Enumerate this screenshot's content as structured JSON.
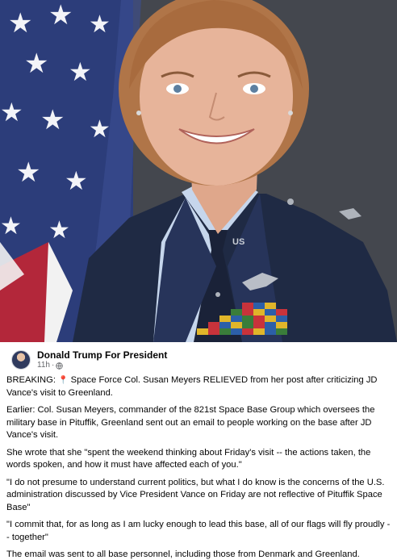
{
  "post": {
    "author": "Donald Trump For President",
    "time": "11h",
    "dot": "·",
    "paragraphs": {
      "p1_before": "BREAKING: ",
      "p1_emoji": "📍",
      "p1_after": " Space Force Col. Susan Meyers RELIEVED from her post after criticizing JD Vance's visit to Greenland.",
      "p2": "Earlier: Col. Susan Meyers, commander of the 821st Space Base Group which oversees the military base in Pituffik, Greenland sent out an email to people working on the base after JD Vance's visit.",
      "p3": "She wrote that she \"spent the weekend thinking about Friday's visit -- the actions taken, the words spoken, and how it must have affected each of you.\"",
      "p4": "\"I do not presume to understand current politics, but what I do know is the concerns of the U.S. administration discussed by Vice President Vance on Friday are not reflective of Pituffik Space Base\"",
      "p5": "\"I commit that, for as long as I am lucky enough to lead this base, all of our flags will fly proudly -- together\"",
      "p6": "The email was sent to all base personnel, including those from Denmark and Greenland."
    }
  },
  "photo": {
    "uniform_tag": "US"
  },
  "colors": {
    "flag_blue": "#2c3d7a",
    "flag_red": "#b3273a",
    "uniform": "#1f2a44",
    "shirt": "#c6d6ec",
    "hair": "#b07548",
    "skin": "#e7b49a"
  },
  "icons": {
    "globe": "globe-icon",
    "avatar": "avatar"
  }
}
